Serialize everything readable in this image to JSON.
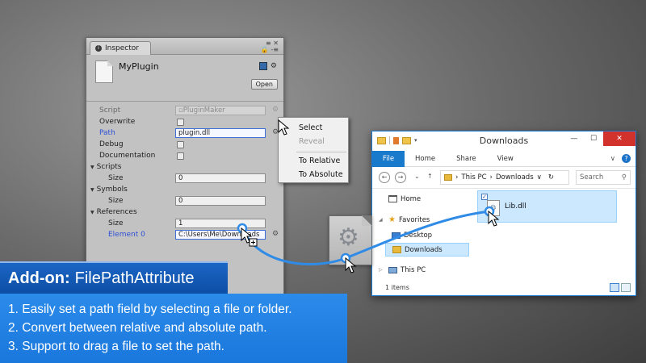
{
  "inspector": {
    "tab_label": "Inspector",
    "window_controls": "≡ ✕",
    "lock_label": "🔒 -≡",
    "object_name": "MyPlugin",
    "open_button": "Open",
    "rows": {
      "script": {
        "label": "Script",
        "value": "PluginMaker"
      },
      "overwrite": {
        "label": "Overwrite"
      },
      "path": {
        "label": "Path",
        "value": "plugin.dll"
      },
      "debug": {
        "label": "Debug"
      },
      "documentation": {
        "label": "Documentation"
      },
      "scripts": {
        "label": "Scripts",
        "size_label": "Size",
        "size_value": "0"
      },
      "symbols": {
        "label": "Symbols",
        "size_label": "Size",
        "size_value": "0"
      },
      "references": {
        "label": "References",
        "size_label": "Size",
        "size_value": "1",
        "element_label": "Element 0",
        "element_value": "C:\\Users\\Me\\Downloads"
      }
    },
    "gear_glyph": "⚙"
  },
  "context_menu": {
    "items": [
      "Select",
      "Reveal",
      "To Relative",
      "To Absolute"
    ],
    "disabled": [
      "Reveal"
    ]
  },
  "explorer": {
    "title": "Downloads",
    "window_buttons": {
      "minimize": "—",
      "maximize": "☐",
      "close": "✕"
    },
    "ribbon_tabs": [
      "File",
      "Home",
      "Share",
      "View"
    ],
    "ribbon_expand": "∨",
    "help": "?",
    "nav_back": "←",
    "nav_forward": "→",
    "nav_recent": "⌄",
    "nav_up": "↑",
    "address": [
      "This PC",
      "Downloads"
    ],
    "address_sep": "›",
    "address_dropdown": "∨",
    "refresh": "↻",
    "search_placeholder": "Search",
    "search_glyph": "⚲",
    "nav_pane": {
      "home": "Home",
      "favorites": "Favorites",
      "desktop": "Desktop",
      "downloads": "Downloads",
      "this_pc": "This PC"
    },
    "file_name": "Lib.dll",
    "checkmark": "✓",
    "status": "1 items"
  },
  "banner": {
    "title_bold": "Add-on:",
    "title_rest": "FilePathAttribute",
    "lines": [
      "1. Easily set a path field by selecting a file or folder.",
      "2. Convert between relative and absolute path.",
      "3. Support to drag a file to set the path."
    ]
  },
  "colors": {
    "accent_blue": "#1b66c4",
    "banner_body": "#2b8bea",
    "drag_arc": "#2f8be6",
    "field_label_blue": "#2f4fd6",
    "close_red": "#d2322c"
  }
}
